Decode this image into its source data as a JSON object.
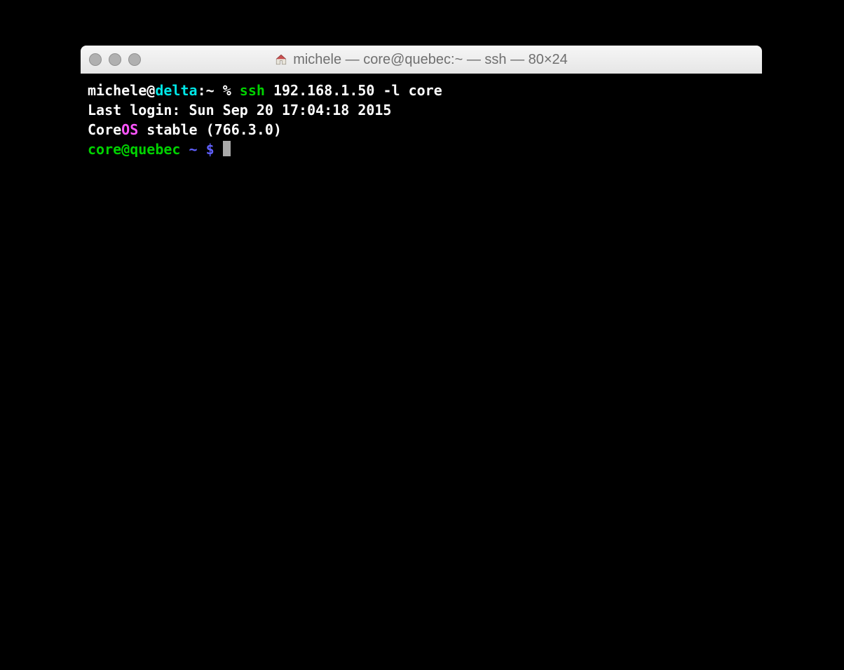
{
  "window": {
    "title": "michele — core@quebec:~ — ssh — 80×24"
  },
  "terminal": {
    "line1": {
      "user": "michele",
      "at": "@",
      "host": "delta",
      "sep": ":",
      "path": "~",
      "pct": " % ",
      "cmd": "ssh",
      "args": " 192.168.1.50 -l core"
    },
    "line2": "Last login: Sun Sep 20 17:04:18 2015",
    "line3": {
      "core": "Core",
      "os": "OS",
      "rest": " stable (766.3.0)"
    },
    "line4": {
      "userhost": "core@quebec",
      "path": " ~ ",
      "dollar": "$ "
    }
  }
}
